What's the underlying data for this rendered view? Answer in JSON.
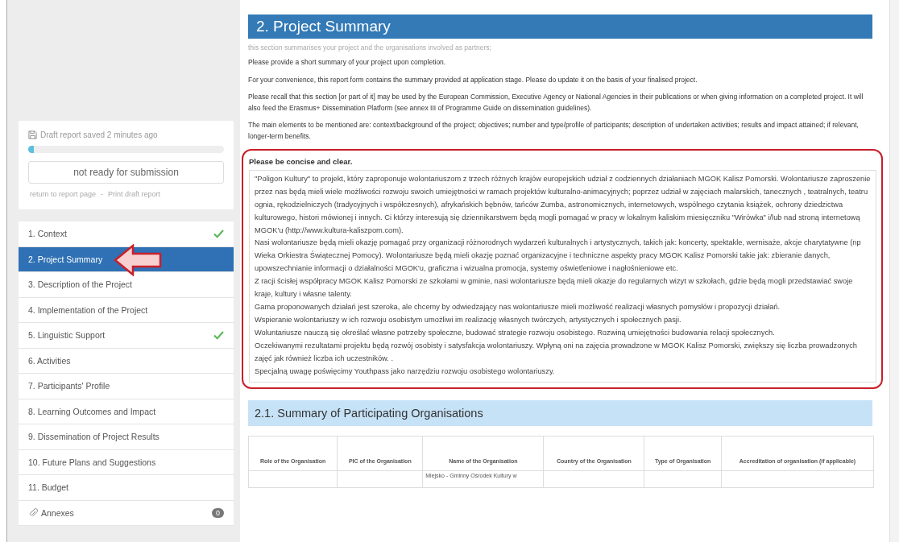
{
  "status_card": {
    "saved_text": "Draft report saved 2 minutes ago",
    "progress": {
      "level": 0.03
    },
    "submission_button": "not ready for submission",
    "links": [
      "return to report page",
      "Print draft report"
    ],
    "link_separator": "-"
  },
  "nav": {
    "items": [
      {
        "label": "1. Context",
        "selected": false,
        "done": true
      },
      {
        "label": "2. Project Summary",
        "selected": true,
        "done": false
      },
      {
        "label": "3. Description of the Project",
        "selected": false,
        "done": false
      },
      {
        "label": "4. Implementation of the Project",
        "selected": false,
        "done": false
      },
      {
        "label": "5. Linguistic Support",
        "selected": false,
        "done": true
      },
      {
        "label": "6. Activities",
        "selected": false,
        "done": false
      },
      {
        "label": "7. Participants' Profile",
        "selected": false,
        "done": false
      },
      {
        "label": "8. Learning Outcomes and Impact",
        "selected": false,
        "done": false
      },
      {
        "label": "9. Dissemination of Project Results",
        "selected": false,
        "done": false
      },
      {
        "label": "10. Future Plans and Suggestions",
        "selected": false,
        "done": false
      },
      {
        "label": "11. Budget",
        "selected": false,
        "done": false
      }
    ],
    "annexes": {
      "label": "Annexes",
      "count": "0"
    }
  },
  "section": {
    "title": "2. Project Summary",
    "subtitle": "this section summarises your project and the organisations involved as partners;",
    "instructions": [
      "Please provide a short summary of your project upon completion.",
      "For your convenience, this report form contains the summary provided at application stage. Please do update it on the basis of your finalised project.",
      "Please recall that this section [or part of it] may be used by the European Commission, Executive Agency or National Agencies in their publications or when giving information on a completed project. It will also feed the Erasmus+ Dissemination Platform (see annex III of Programme Guide on dissemination guidelines).",
      "The main elements to be mentioned are: context/background of the project; objectives; number and type/profile of participants; description of undertaken activities; results and impact attained; if relevant, longer-term benefits."
    ],
    "field_label": "Please be concise and clear.",
    "summary": [
      "\"Poligon Kultury\" to projekt, który zaproponuje wolontariuszom z trzech różnych krajów europejskich udział z codziennych działaniach MGOK Kalisz Pomorski. Wolontariusze zaproszenie przez nas będą mieli wiele możliwości rozwoju swoich umiejętności w ramach projektów kulturalno-animacyjnych; poprzez udział w zajęciach malarskich, tanecznych , teatralnych, teatru ognia, rękodzielniczych (tradycyjnych i współczesnych), afrykańskich bębnów, tańców Zumba, astronomicznych, internetowych, wspólnego czytania książek, ochrony dziedzictwa kulturowego, histori mówionej i innych. Ci którzy interesują się dziennikarstwem będą mogli pomagać w pracy w lokalnym kaliskim miesięczniku \"Wirówka\" i/lub nad stroną internetową MGOK'u (http://www.kultura-kaliszpom.com).",
      "Nasi wolontariusze będą mieli okazję pomagać przy organizacji różnorodnych wydarzeń kulturalnych i artystycznych, takich jak: koncerty, spektakle, wernisaże, akcje charytatywne (np Wieka Orkiestra Świątecznej Pomocy). Wolontariusze będą mieli okazję poznać organizacyjne i techniczne aspekty pracy MGOK Kalisz Pomorski takie jak: zbieranie danych, upowszechnianie informacji o działalności MGOK'u, graficzna i wizualna promocja, systemy oświetleniowe i nagłośnieniowe etc.",
      "Z racji ścisłej współpracy MGOK Kalisz Pomorski ze szkołami w gminie, nasi wolontariusze będą mieli okazje do regularnych wizyt w szkołach, gdzie będą mogli przedstawiać swoje kraje, kultury i własne talenty.",
      "Gama proponowanych działań jest szeroka, ale chcemy by odwiedzający nas wolontariusze mieli możliwość realizacji własnych pomysłów i propozycji działań.",
      "Wspieranie wolontariuszy w ich rozwoju osobistym umożliwi im realizację własnych twórczych, artystycznych i społecznych pasji.",
      "Woluntariusze nauczą się określać własne potrzeby społeczne, budować strategie rozwoju osobistego. Rozwiną umiejętności budowania relacji społecznych.",
      "Oczekiwanymi rezultatami projektu będą rozwój osobisty i satysfakcja wolontariuszy. Wpłyną oni na zajęcia prowadzone w MGOK Kalisz Pomorski, zwiększy się liczba prowadzonych zajęć jak również liczba ich uczestników. .",
      "Specjalną uwagę poświęcimy Youthpass jako narzędziu rozwoju osobistego wolontariuszy."
    ]
  },
  "organisations": {
    "title": "2.1. Summary of Participating Organisations",
    "table": {
      "columns": [
        "Role of the Organisation",
        "PIC of the Organisation",
        "Name of the Organisation",
        "Country of the Organisation",
        "Type of Organisation",
        "Accreditation of organisation (if applicable)"
      ],
      "rows": [
        {
          "column_3": "Miejsko - Gminny Ośrodek Kultury w"
        }
      ]
    }
  }
}
